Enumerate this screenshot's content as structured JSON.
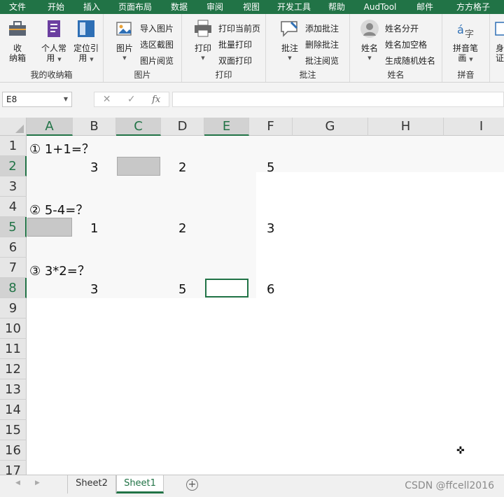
{
  "ribbon_tabs": [
    "文件",
    "开始",
    "插入",
    "页面布局",
    "数据",
    "审阅",
    "视图",
    "开发工具",
    "帮助",
    "AudTool",
    "邮件",
    "方方格子"
  ],
  "ribbon": {
    "favorites": {
      "label": "我的收纳箱",
      "btn_storage": [
        "收",
        "纳箱"
      ],
      "btn_personal": [
        "个人常",
        "用"
      ],
      "btn_locate": [
        "定位引",
        "用"
      ]
    },
    "picture": {
      "label": "图片",
      "btn_picture": "图片",
      "small": [
        "导入图片",
        "选区截图",
        "图片阅览"
      ]
    },
    "print": {
      "label": "打印",
      "btn_print": "打印",
      "small": [
        "打印当前页",
        "批量打印",
        "双面打印"
      ]
    },
    "comment": {
      "label": "批注",
      "btn_comment": "批注",
      "small": [
        "添加批注",
        "删除批注",
        "批注阅览"
      ]
    },
    "name": {
      "label": "姓名",
      "btn_name": "姓名",
      "small": [
        "姓名分开",
        "姓名加空格",
        "生成随机姓名"
      ]
    },
    "pinyin": {
      "label": "拼音",
      "btn_pinyin": [
        "拼音笔",
        "画"
      ],
      "btn_cut": [
        "身",
        "证"
      ]
    }
  },
  "formula_bar": {
    "name_box": "E8",
    "formula": ""
  },
  "columns": [
    "A",
    "B",
    "C",
    "D",
    "E",
    "F",
    "G",
    "H",
    "I"
  ],
  "rows": [
    "1",
    "2",
    "3",
    "4",
    "5",
    "6",
    "7",
    "8",
    "9",
    "10",
    "11",
    "12",
    "13",
    "14",
    "15",
    "16",
    "17"
  ],
  "cells": {
    "A1": "① 1+1=？",
    "B2": "3",
    "D2": "2",
    "F2": "5",
    "A4": "② 5-4=？",
    "B5": "1",
    "D5": "2",
    "F5": "3",
    "A7": "③ 3*2=？",
    "B8": "3",
    "D8": "5",
    "F8": "6"
  },
  "sheets": [
    "Sheet2",
    "Sheet1"
  ],
  "active_sheet": "Sheet1",
  "watermark": "CSDN @ffcell2016",
  "colors": {
    "accent": "#217346",
    "placeholder_fill": "#c8c8c8"
  }
}
